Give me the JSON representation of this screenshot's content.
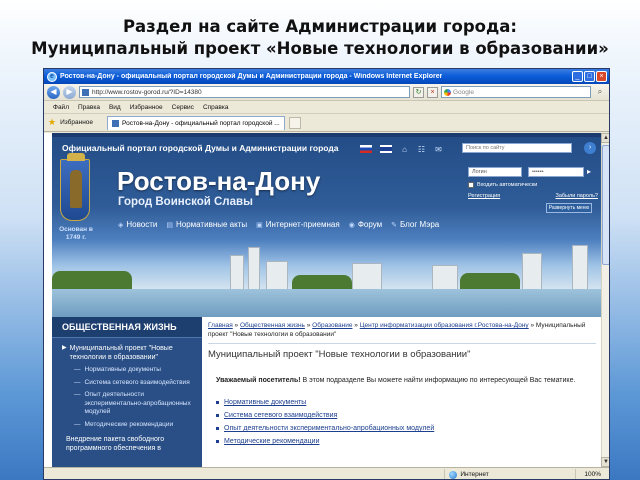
{
  "slide": {
    "title_line1": "Раздел на сайте Администрации города:",
    "title_line2": "Муниципальный проект «Новые технологии в образовании»"
  },
  "browser": {
    "window_title": "Ростов-на-Дону - официальный портал городской Думы и Администрации города - Windows Internet Explorer",
    "url": "http://www.rostov-gorod.ru/?ID=14380",
    "search_placeholder": "Google",
    "menu": [
      "Файл",
      "Правка",
      "Вид",
      "Избранное",
      "Сервис",
      "Справка"
    ],
    "favorites_label": "Избранное",
    "tab_label": "Ростов-на-Дону - официальный портал городской ...",
    "status_zone": "Интернет",
    "zoom": "100%",
    "ie_icon": "ie-logo",
    "back_icon": "back-arrow-icon",
    "forward_icon": "forward-arrow-icon",
    "refresh_icon": "refresh-icon",
    "stop_icon": "stop-icon"
  },
  "site": {
    "portal_title": "Официальный портал городской Думы и Администрации города",
    "city_name": "Ростов-на-Дону",
    "city_motto": "Город Воинской Славы",
    "founded": "Основан в 1749 г.",
    "search_placeholder": "Поиск по сайту",
    "login_user": "Логин",
    "login_pass": "••••••",
    "remember_label": "Входить автоматически",
    "register_link": "Регистрация",
    "forgot_link": "Забыли пароль?",
    "expand_label": "Развернуть меню",
    "nav": [
      "Новости",
      "Нормативные акты",
      "Интернет-приемная",
      "Форум",
      "Блог Мэра"
    ],
    "colors": {
      "header_blue": "#234c86",
      "sidebar_blue": "#294f86",
      "link_blue": "#1d3f8f"
    }
  },
  "sidebar": {
    "section_title": "ОБЩЕСТВЕННАЯ ЖИЗНЬ",
    "active_item": "Муниципальный проект \"Новые технологии в образовании\"",
    "sub_items": [
      "Нормативные документы",
      "Система сетевого взаимодействия",
      "Опыт деятельности экспериментально-апробационных модулей",
      "Методические рекомендации"
    ],
    "other_item": "Внедрение пакета свободного программного обеспечения в"
  },
  "main": {
    "breadcrumb": {
      "home": "Главная",
      "social": "Общественная жизнь",
      "education": "Образование",
      "center": "Центр информатизации образования г.Ростова-на-Дону",
      "current": "Муниципальный проект \"Новые технологии в образовании\""
    },
    "heading": "Муниципальный проект \"Новые технологии в образовании\"",
    "intro_bold": "Уважаемый посетитель!",
    "intro_text": "В этом подразделе Вы можете найти информацию по интересующей Вас тематике.",
    "links": [
      "Нормативные документы",
      "Система сетевого взаимодействия",
      "Опыт деятельности экспериментально-апробационных модулей",
      "Методические рекомендации"
    ]
  }
}
